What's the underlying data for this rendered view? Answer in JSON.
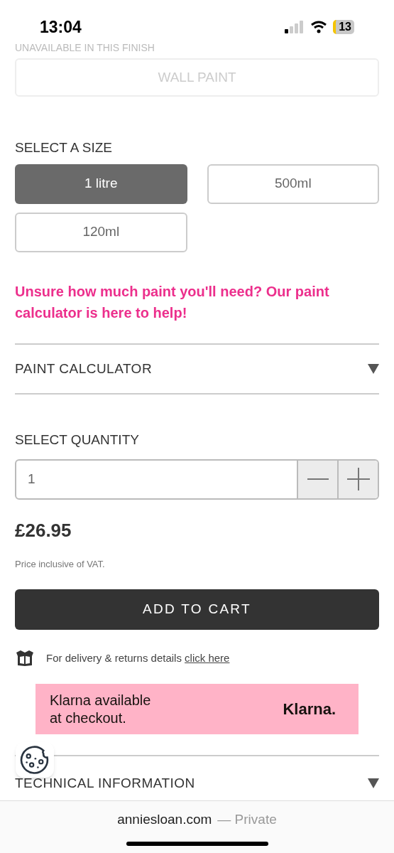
{
  "status_bar": {
    "time": "13:04",
    "battery": "13"
  },
  "finish": {
    "note": "UNAVAILABLE IN THIS FINISH",
    "option": "WALL PAINT",
    "disabled": true
  },
  "size": {
    "label": "SELECT A SIZE",
    "options": [
      {
        "label": "1 litre",
        "selected": true
      },
      {
        "label": "500ml",
        "selected": false
      },
      {
        "label": "120ml",
        "selected": false
      }
    ]
  },
  "calculator_prompt": "Unsure how much paint you'll need? Our paint calculator is here to help!",
  "accordions": [
    {
      "label": "PAINT CALCULATOR",
      "expanded": false
    }
  ],
  "quantity": {
    "label": "SELECT QUANTITY",
    "value": "1"
  },
  "price": "£26.95",
  "price_note": "Price inclusive of VAT.",
  "add_to_cart": "ADD TO CART",
  "delivery": {
    "text": "For delivery & returns details",
    "link": "click here"
  },
  "klarna": {
    "text": "Klarna available at checkout.",
    "logo": "Klarna."
  },
  "bottom_accordions": [
    {
      "label": "TECHNICAL INFORMATION",
      "expanded": false
    }
  ],
  "browser_bar": {
    "domain": "anniesloan.com",
    "mode": "— Private"
  }
}
